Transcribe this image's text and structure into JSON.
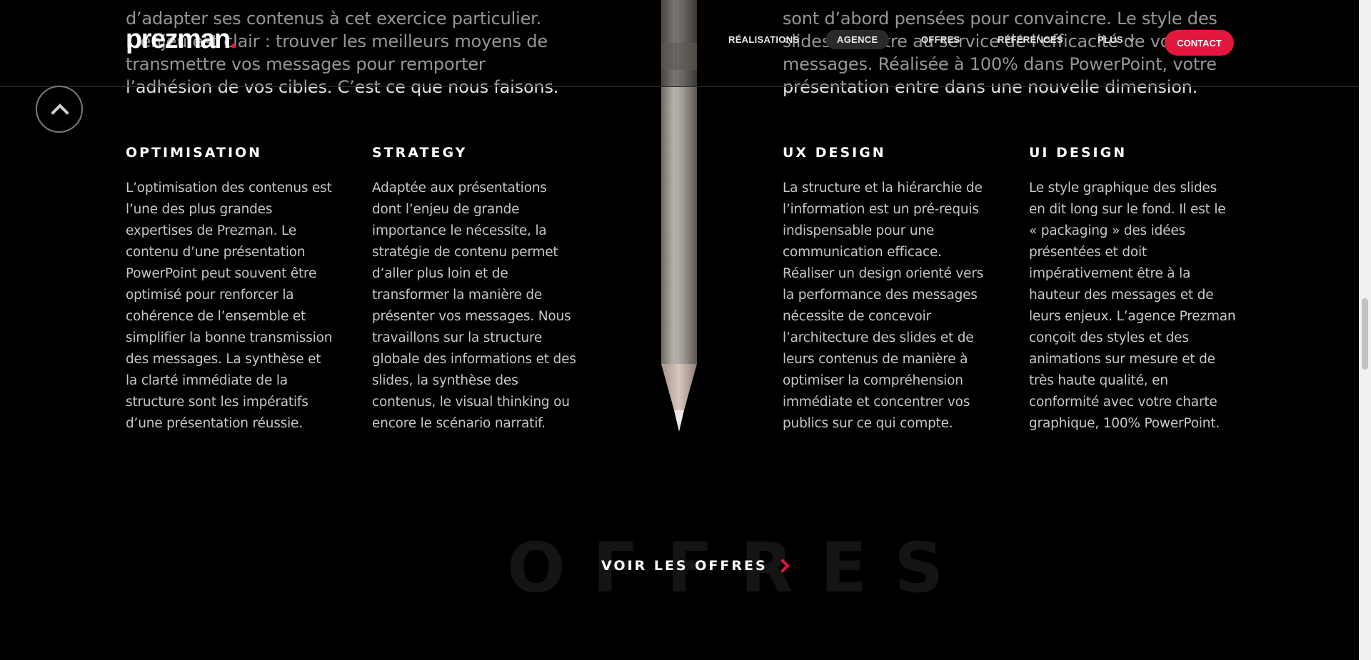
{
  "intro": {
    "left": "d’adapter ses contenus à cet exercice particulier. L’enjeu est clair : trouver les meilleurs moyens de transmettre vos messages pour remporter l’adhésion de vos cibles. C’est ce que nous faisons.",
    "right": "sont d’abord pensées pour convaincre. Le style des slides doit être au service de l’efficacité de vos messages. Réalisée à 100% dans PowerPoint, votre présentation entre dans une nouvelle dimension."
  },
  "header": {
    "logo": "prezman",
    "logo_dot": ".",
    "nav": {
      "realisations": "RÉALISATIONS",
      "agence": "AGENCE",
      "offres": "OFFRES",
      "references": "RÉFÉRENCES",
      "plus": "PLUS"
    },
    "contact": "CONTACT"
  },
  "columns": [
    {
      "title": "OPTIMISATION",
      "text": "L’optimisation des contenus est l’une des plus grandes expertises de Prezman. Le contenu d’une présentation PowerPoint peut souvent être optimisé pour renforcer la cohérence de l’ensemble et simplifier la bonne transmission des messages. La synthèse et la clarté immédiate de la structure sont les impératifs d’une présentation réussie."
    },
    {
      "title": "STRATEGY",
      "text": "Adaptée aux présentations dont l’enjeu de grande importance le nécessite, la stratégie de contenu permet d’aller plus loin et de transformer la manière de présenter vos messages. Nous travaillons sur la structure globale des informations et des slides, la synthèse des contenus, le visual thinking ou encore le scénario narratif."
    },
    {
      "title": "UX DESIGN",
      "text": "La structure et la hiérarchie de l’information est un pré-requis indispensable pour une communication efficace. Réaliser un design orienté vers la performance des messages nécessite de concevoir l’architecture des slides et de leurs contenus de manière à optimiser la compréhension immédiate et concentrer vos publics sur ce qui compte."
    },
    {
      "title": "UI DESIGN",
      "text": "Le style graphique des slides en dit long sur le fond. Il est le « packaging » des idées présentées et doit impérativement être à la hauteur des messages et de leurs enjeux. L’agence Prezman conçoit des styles et des animations sur mesure et de très haute qualité, en conformité avec votre charte graphique, 100% PowerPoint."
    }
  ],
  "offres": {
    "background_word": "OFFRES",
    "cta": "VOIR LES OFFRES"
  },
  "icons": {
    "scroll_top": "chevron-up-icon",
    "plus_menu": "chevron-down-icon",
    "cta_arrow": "chevron-right-icon"
  },
  "colors": {
    "accent": "#e3173e",
    "background": "#000000",
    "body_text": "#c6c6c6"
  }
}
